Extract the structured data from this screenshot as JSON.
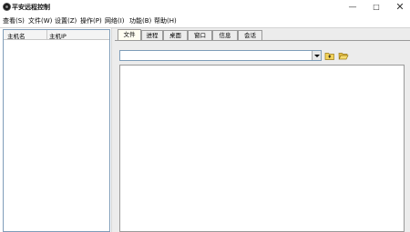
{
  "window": {
    "title": "平安远程控制",
    "minimize_glyph": "—",
    "maximize_glyph": "□",
    "close_glyph": "✕"
  },
  "menu": [
    {
      "label": "查看(S)"
    },
    {
      "label": "文件(W)"
    },
    {
      "label": "设置(Z)"
    },
    {
      "label": "操作(P)"
    },
    {
      "label": "网络(I)"
    },
    {
      "label": "功能(B)"
    },
    {
      "label": "帮助(H)"
    }
  ],
  "host_list": {
    "columns": [
      "主机名",
      "主机IP"
    ],
    "rows": []
  },
  "tabs": [
    {
      "label": "文件",
      "active": true
    },
    {
      "label": "进程",
      "active": false
    },
    {
      "label": "桌面",
      "active": false
    },
    {
      "label": "窗口",
      "active": false
    },
    {
      "label": "信息",
      "active": false
    },
    {
      "label": "会话",
      "active": false
    }
  ],
  "file_panel": {
    "path_value": "",
    "tools": [
      "folder-up-icon",
      "open-folder-icon"
    ],
    "entries": []
  }
}
